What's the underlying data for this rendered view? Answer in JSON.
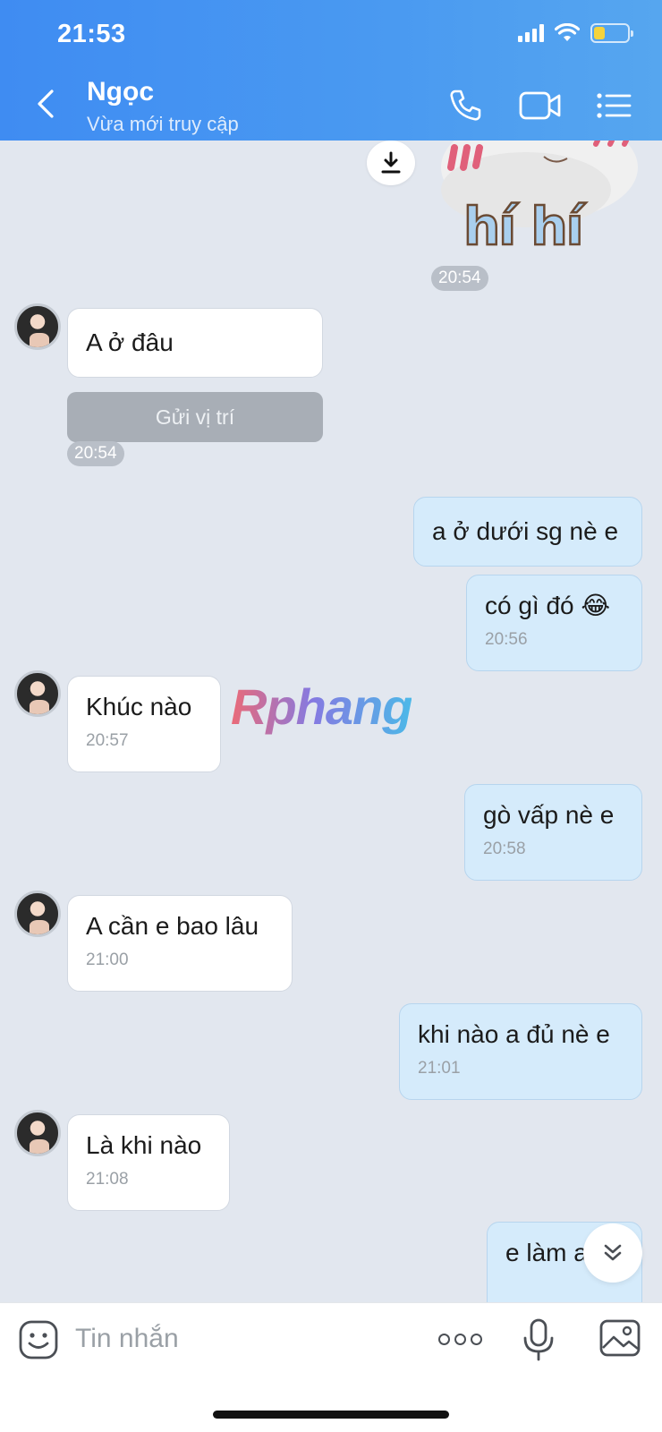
{
  "status_bar": {
    "time": "21:53"
  },
  "header": {
    "contact_name": "Ngọc",
    "contact_status": "Vừa mới truy cập",
    "icons": [
      "back-icon",
      "phone-icon",
      "video-icon",
      "menu-list-icon"
    ]
  },
  "sticker": {
    "text": "hí hí",
    "time": "20:54"
  },
  "messages": [
    {
      "from": "them",
      "text": "A ở đâu"
    },
    {
      "from": "them",
      "type": "location_button",
      "text": "Gửi vị trí",
      "time": "20:54"
    },
    {
      "from": "me",
      "text": "a ở dưới sg nè e"
    },
    {
      "from": "me",
      "text": "có gì đó 😂",
      "time": "20:56"
    },
    {
      "from": "them",
      "text": "Khúc nào",
      "time": "20:57"
    },
    {
      "from": "me",
      "text": "gò vấp nè e",
      "time": "20:58"
    },
    {
      "from": "them",
      "text": "A cần e bao lâu",
      "time": "21:00"
    },
    {
      "from": "me",
      "text": "khi nào a đủ nè e",
      "time": "21:01"
    },
    {
      "from": "them",
      "text": "Là khi nào",
      "time": "21:08"
    },
    {
      "from": "me",
      "text": "e làm a ra"
    }
  ],
  "watermark": "Rphang",
  "composer": {
    "placeholder": "Tin nhắn"
  },
  "colors": {
    "header": "#4a9af1",
    "my_bubble": "#d5ebfb",
    "their_bubble": "#ffffff",
    "background": "#e2e7ef"
  }
}
